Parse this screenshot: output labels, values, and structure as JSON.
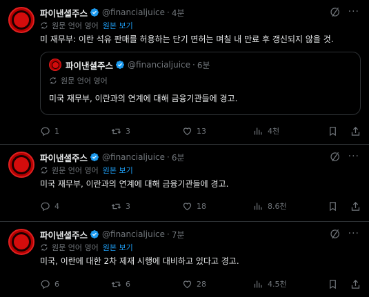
{
  "tweets": [
    {
      "name": "파이낸셜주스",
      "handle": "@financialjuice",
      "time": "4분",
      "translation": {
        "label": "원문 언어 영어",
        "show": "원본 보기"
      },
      "text": "미 재무부: 이란 석유 판매를 허용하는 단기 면허는 며칠 내 만료 후 갱신되지 않을 것.",
      "quote": {
        "name": "파이낸셜주스",
        "handle": "@financialjuice",
        "time": "6분",
        "translation": {
          "label": "원문 언어 영어"
        },
        "text": "미국 재무부, 이란과의 연계에 대해 금융기관들에 경고."
      },
      "stats": {
        "replies": "1",
        "reposts": "3",
        "likes": "13",
        "views": "4천"
      }
    },
    {
      "name": "파이낸셜주스",
      "handle": "@financialjuice",
      "time": "6분",
      "translation": {
        "label": "원문 언어 영어",
        "show": "원본 보기"
      },
      "text": "미국 재무부, 이란과의 연계에 대해 금융기관들에 경고.",
      "stats": {
        "replies": "4",
        "reposts": "3",
        "likes": "18",
        "views": "8.6천"
      }
    },
    {
      "name": "파이낸셜주스",
      "handle": "@financialjuice",
      "time": "7분",
      "translation": {
        "label": "원문 언어 영어",
        "show": "원본 보기"
      },
      "text": "미국, 이란에 대한 2차 제재 시행에 대비하고 있다고 경고.",
      "stats": {
        "replies": "6",
        "reposts": "6",
        "likes": "28",
        "views": "4.5천"
      }
    }
  ],
  "icons": {
    "verified": "verified-badge-icon",
    "grok": "grok-icon",
    "more": "more-icon",
    "translate": "translate-icon",
    "reply": "reply-icon",
    "repost": "repost-icon",
    "like": "like-icon",
    "views": "views-icon",
    "bookmark": "bookmark-icon",
    "share": "share-icon"
  },
  "colors": {
    "background": "#000000",
    "accent": "#1d9bf0",
    "muted": "#71767b",
    "brand": "#d40c0c"
  }
}
